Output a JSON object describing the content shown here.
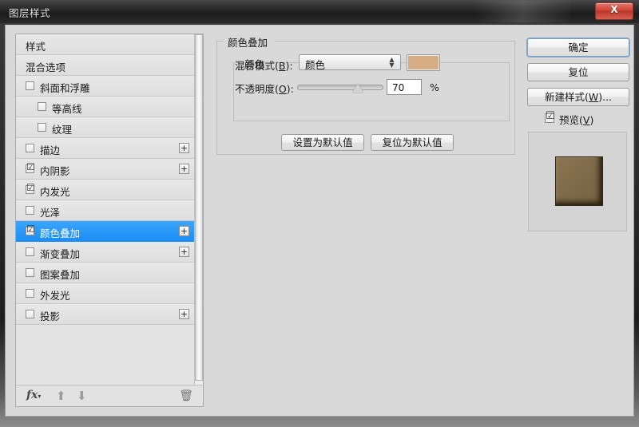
{
  "window": {
    "title": "图层样式",
    "close_label": "X",
    "close_icon": "close-icon"
  },
  "colors": {
    "selection_blue": "#1b8ef5",
    "overlay_swatch": "#d6ad84",
    "preview_square": "#7c6947",
    "dialog_bg": "#d9d9d9",
    "titlebar": "#2c2c2c",
    "close_red": "#cf4437"
  },
  "sidebar": {
    "items": [
      {
        "label": "样式",
        "indent": false,
        "checkbox": false,
        "checked": false,
        "plus": false,
        "selected": false
      },
      {
        "label": "混合选项",
        "indent": false,
        "checkbox": false,
        "checked": false,
        "plus": false,
        "selected": false
      },
      {
        "label": "斜面和浮雕",
        "indent": false,
        "checkbox": true,
        "checked": false,
        "plus": false,
        "selected": false
      },
      {
        "label": "等高线",
        "indent": true,
        "checkbox": true,
        "checked": false,
        "plus": false,
        "selected": false
      },
      {
        "label": "纹理",
        "indent": true,
        "checkbox": true,
        "checked": false,
        "plus": false,
        "selected": false
      },
      {
        "label": "描边",
        "indent": false,
        "checkbox": true,
        "checked": false,
        "plus": true,
        "selected": false
      },
      {
        "label": "内阴影",
        "indent": false,
        "checkbox": true,
        "checked": true,
        "plus": true,
        "selected": false
      },
      {
        "label": "内发光",
        "indent": false,
        "checkbox": true,
        "checked": true,
        "plus": false,
        "selected": false
      },
      {
        "label": "光泽",
        "indent": false,
        "checkbox": true,
        "checked": false,
        "plus": false,
        "selected": false
      },
      {
        "label": "颜色叠加",
        "indent": false,
        "checkbox": true,
        "checked": true,
        "plus": true,
        "selected": true
      },
      {
        "label": "渐变叠加",
        "indent": false,
        "checkbox": true,
        "checked": false,
        "plus": true,
        "selected": false
      },
      {
        "label": "图案叠加",
        "indent": false,
        "checkbox": true,
        "checked": false,
        "plus": false,
        "selected": false
      },
      {
        "label": "外发光",
        "indent": false,
        "checkbox": true,
        "checked": false,
        "plus": false,
        "selected": false
      },
      {
        "label": "投影",
        "indent": false,
        "checkbox": true,
        "checked": false,
        "plus": true,
        "selected": false
      }
    ],
    "check_glyph": "☑",
    "plus_glyph": "+",
    "toolbar": {
      "fx_label": "fx",
      "fx_caret": "▾",
      "move_up_glyph": "⬆",
      "move_down_glyph": "⬇",
      "delete_glyph": "🗑"
    }
  },
  "main": {
    "group_title": "颜色叠加",
    "subgroup_title": "颜色",
    "blend_mode": {
      "label_prefix": "混合模式(",
      "label_accel": "B",
      "label_suffix": "):",
      "value": "颜色",
      "spinner_glyph": "⇕"
    },
    "opacity": {
      "label_prefix": "不透明度(",
      "label_accel": "O",
      "label_suffix": "):",
      "value": "70",
      "unit": "%",
      "percent": 70
    },
    "buttons": {
      "set_default": "设置为默认值",
      "reset_default": "复位为默认值"
    }
  },
  "right": {
    "ok_label": "确定",
    "reset_label": "复位",
    "new_style_prefix": "新建样式(",
    "new_style_accel": "W",
    "new_style_suffix": ")...",
    "preview_prefix": "预览(",
    "preview_accel": "V",
    "preview_suffix": ")",
    "preview_checked": true,
    "preview_check_glyph": "☑"
  }
}
